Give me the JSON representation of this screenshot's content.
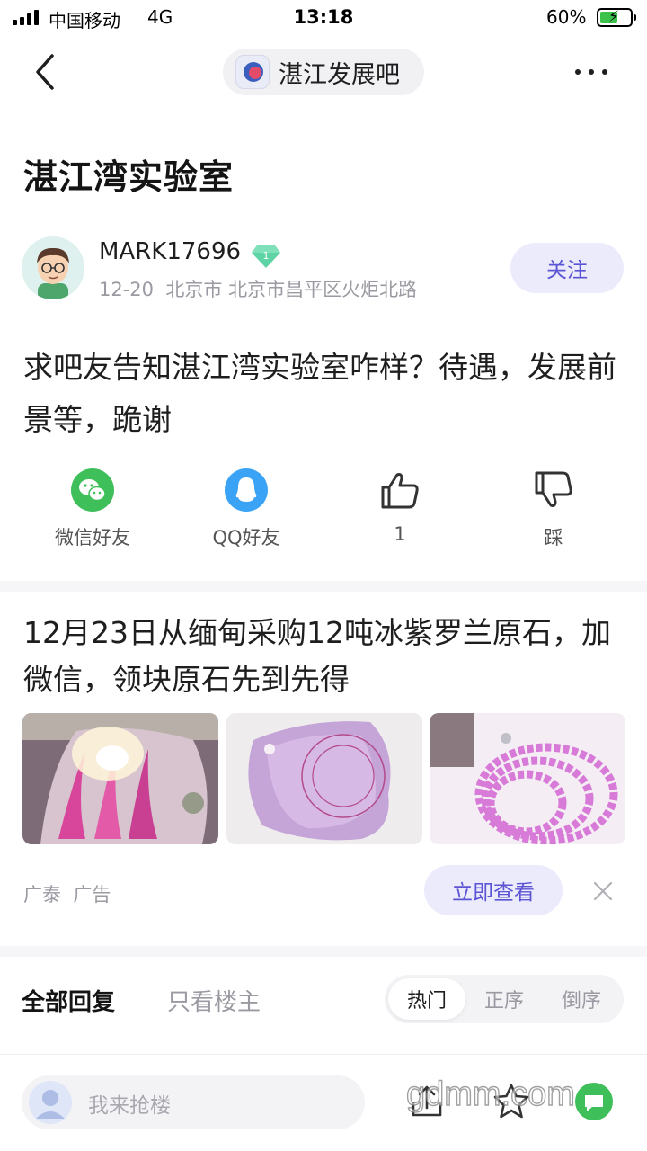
{
  "status_bar": {
    "carrier": "中国移动",
    "network": "4G",
    "time": "13:18",
    "battery": "60%",
    "battery_level": 0.6
  },
  "nav": {
    "forum_name": "湛江发展吧"
  },
  "post": {
    "title": "湛江湾实验室",
    "author": "MARK17696",
    "level": "1",
    "date": "12-20",
    "location": "北京市 北京市昌平区火炬北路",
    "follow_label": "关注",
    "body": "求吧友告知湛江湾实验室咋样？待遇，发展前景等，跪谢"
  },
  "actions": {
    "wechat_label": "微信好友",
    "qq_label": "QQ好友",
    "like_count": "1",
    "dislike_label": "踩"
  },
  "ad": {
    "title": "12月23日从缅甸采购12吨冰紫罗兰原石，加微信，领块原石先到先得",
    "source": "广泰",
    "tag": "广告",
    "cta_label": "立即查看"
  },
  "replies": {
    "tab_all": "全部回复",
    "tab_op_only": "只看楼主",
    "sort_options": [
      "热门",
      "正序",
      "倒序"
    ]
  },
  "bottom_bar": {
    "input_placeholder": "我来抢楼",
    "watermark": "gdmm.com"
  },
  "colors": {
    "accent": "#5b54d4",
    "accent_bg": "#ecebfb",
    "wechat": "#3fbf5a",
    "qq": "#3aa3f5",
    "level_badge": "#5ed3a5"
  },
  "icons": [
    "back-arrow-icon",
    "more-dots-icon",
    "wechat-icon",
    "qq-icon",
    "thumbs-up-icon",
    "thumbs-down-icon",
    "close-icon",
    "share-icon",
    "star-icon",
    "chat-icon"
  ]
}
